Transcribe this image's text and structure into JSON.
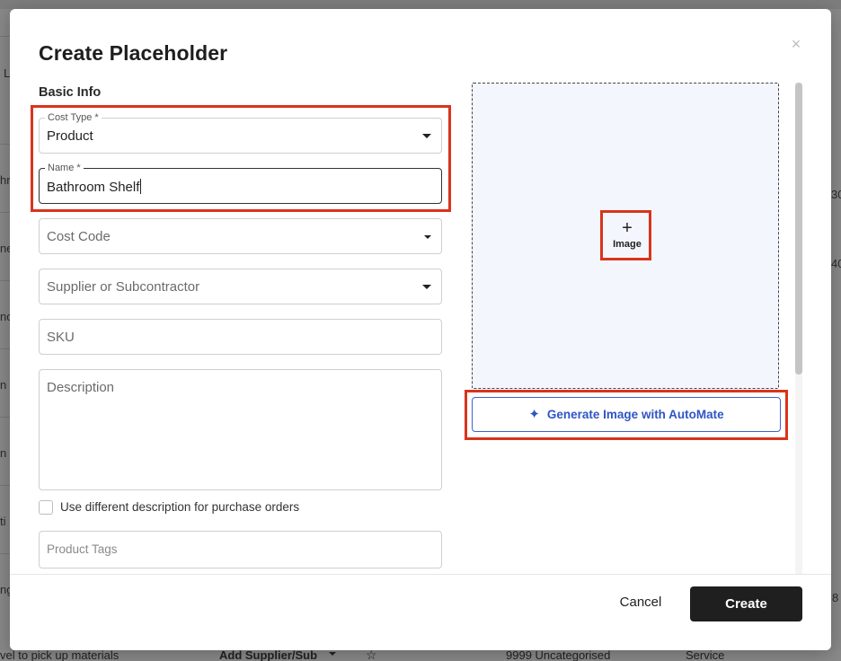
{
  "modal": {
    "title": "Create Placeholder",
    "close_symbol": "×",
    "section_title": "Basic Info",
    "fields": {
      "cost_type": {
        "label": "Cost Type *",
        "value": "Product"
      },
      "name": {
        "label": "Name *",
        "value": "Bathroom Shelf"
      },
      "cost_code": {
        "placeholder": "Cost Code"
      },
      "supplier": {
        "placeholder": "Supplier or Subcontractor"
      },
      "sku": {
        "placeholder": "SKU"
      },
      "description": {
        "placeholder": "Description"
      },
      "different_description": {
        "label": "Use different description for purchase orders",
        "checked": false
      },
      "product_tags": {
        "placeholder": "Product Tags"
      }
    },
    "image": {
      "plus_symbol": "+",
      "label": "Image",
      "generate_label": "Generate Image with AutoMate",
      "sparkle_symbol": "✦"
    },
    "footer": {
      "cancel_label": "Cancel",
      "create_label": "Create"
    }
  },
  "background": {
    "fragments_left": [
      "L",
      "hr",
      "ne",
      "no",
      "n",
      "n",
      "ti",
      "ng"
    ],
    "fragments_right": [
      "30",
      "40",
      "8"
    ],
    "bottom_row": {
      "task": "vel to pick up materials",
      "supplier_label": "Add Supplier/Sub",
      "cost_code": "9999 Uncategorised",
      "type": "Service"
    }
  },
  "colors": {
    "highlight": "#d9341c",
    "accent": "#2f55c4",
    "primary_button": "#1f1f1f",
    "dropzone_bg": "#f3f6fc"
  },
  "icons": [
    "close-icon",
    "dropdown-caret-icon",
    "plus-icon",
    "sparkle-icon",
    "star-icon",
    "checkbox-icon"
  ]
}
